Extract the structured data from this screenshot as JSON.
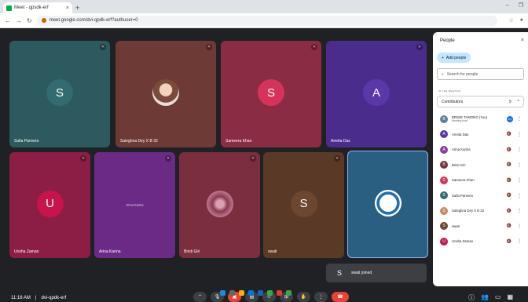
{
  "browser": {
    "tab_title": "Meet - qpsdk-erf",
    "url": "meet.google.com/dvi-qpdk-erf?authuser=0"
  },
  "tiles": [
    {
      "name": "Sufia Parveen",
      "initial": "S",
      "bg": "#2d5a5e",
      "avatar_color": "#336b70",
      "kind": "initial"
    },
    {
      "name": "Suleghna Dey X B 32",
      "initial": "",
      "bg": "#6e3a36",
      "kind": "photo"
    },
    {
      "name": "Sameera Khan",
      "initial": "S",
      "bg": "#8a2c44",
      "avatar_color": "#d6335c",
      "kind": "initial"
    },
    {
      "name": "Amrita Das",
      "initial": "A",
      "bg": "#4a2c8c",
      "avatar_color": "#5b38a8",
      "kind": "initial"
    },
    {
      "name": "Unsha Zaman",
      "initial": "U",
      "bg": "#8c1e45",
      "avatar_color": "#c9134d",
      "kind": "initial"
    },
    {
      "name": "Arina Karina",
      "initial": "",
      "bg": "#6a2a86",
      "kind": "text",
      "center_text": "Arina Karina"
    },
    {
      "name": "Bristi Giri",
      "initial": "",
      "bg": "#7a2e3e",
      "kind": "photo2"
    },
    {
      "name": "swati",
      "initial": "S",
      "bg": "#5a3a26",
      "avatar_color": "#6b4630",
      "kind": "initial"
    },
    {
      "name": "",
      "initial": "",
      "bg": "#2b5f82",
      "kind": "logo"
    }
  ],
  "toast": {
    "initial": "S",
    "text": "swati joined"
  },
  "meeting": {
    "time": "11:16 AM",
    "code": "dvi-qpdk-erf"
  },
  "controls": {
    "mic_icon": "mic-off-icon",
    "cam_icon": "camera-off-icon",
    "captions_icon": "captions-icon",
    "emoji_icon": "emoji-icon",
    "present_icon": "present-icon",
    "hand_icon": "raise-hand-icon",
    "more_icon": "more-icon",
    "end_icon": "end-call-icon"
  },
  "people_panel": {
    "title": "People",
    "add_people": "Add people",
    "search_placeholder": "Search for people",
    "in_meeting_label": "IN THE MEETING",
    "contributors_label": "Contributors",
    "contributors_count": "9",
    "people": [
      {
        "name": "BRISIE TAMONG (You)",
        "sub": "Meeting host",
        "initial": "B",
        "color": "#5f7f99"
      },
      {
        "name": "Amrita Das",
        "sub": "",
        "initial": "A",
        "color": "#5b38a8"
      },
      {
        "name": "Arina Karina",
        "sub": "",
        "initial": "A",
        "color": "#8a3fa0"
      },
      {
        "name": "Bristi Giri",
        "sub": "",
        "initial": "B",
        "color": "#7a2e3e"
      },
      {
        "name": "Sameera Khan",
        "sub": "",
        "initial": "S",
        "color": "#d6335c"
      },
      {
        "name": "Sufia Parveen",
        "sub": "",
        "initial": "S",
        "color": "#336b70"
      },
      {
        "name": "Suleghna Dey X B 32",
        "sub": "",
        "initial": "S",
        "color": "#c98a5a"
      },
      {
        "name": "swati",
        "sub": "",
        "initial": "S",
        "color": "#6b4630"
      },
      {
        "name": "Unsha Zaman",
        "sub": "",
        "initial": "U",
        "color": "#c9134d"
      }
    ]
  }
}
